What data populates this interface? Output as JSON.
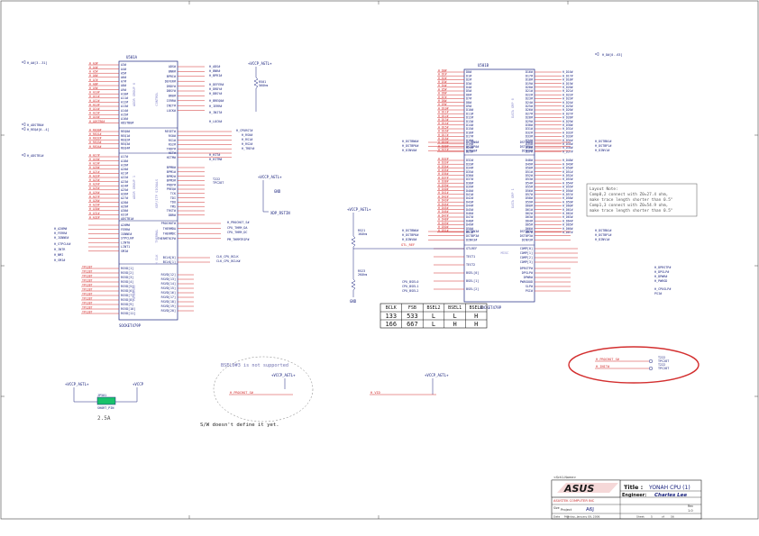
{
  "u1": {
    "ref": "U501A",
    "part": "SOCKET479P",
    "left_a_pins": [
      "A3#",
      "A4#",
      "A5#",
      "A6#",
      "A7#",
      "A8#",
      "A9#",
      "A10#",
      "A11#",
      "A12#",
      "A13#",
      "A14#",
      "A15#",
      "A16#",
      "ADSTB0#"
    ],
    "left_req_pins": [
      "REQ0#",
      "REQ1#",
      "REQ2#",
      "REQ3#",
      "REQ4#"
    ],
    "left_b_pins": [
      "A17#",
      "A18#",
      "A19#",
      "A20#",
      "A21#",
      "A22#",
      "A23#",
      "A24#",
      "A25#",
      "A26#",
      "A27#",
      "A28#",
      "A29#",
      "A30#",
      "A31#",
      "ADSTB1#"
    ],
    "left_misc_pins": [
      "A20M#",
      "FERR#",
      "IGNNE#",
      "STPCLK#",
      "LINT0",
      "LINT1",
      "SMI#"
    ],
    "left_rsvd_pins": [
      "RSVD[1]",
      "RSVD[2]",
      "RSVD[3]",
      "RSVD[4]",
      "RSVD[5]",
      "RSVD[6]",
      "RSVD[7]",
      "RSVD[8]",
      "RSVD[9]",
      "RSVD[10]",
      "RSVD[11]"
    ],
    "right_ctrl_pins": [
      "ADS#",
      "BNR#",
      "BPRI#",
      "DEFER#",
      "DRDY#",
      "DBSY#",
      "BR0#",
      "IERR#",
      "INIT#",
      "LOCK#"
    ],
    "right_rs_pins": [
      "RESET#",
      "RS0#",
      "RS1#",
      "RS2#",
      "TRDY#",
      "HIT#",
      "HITM#"
    ],
    "right_bpm_pins": [
      "BPM0#",
      "BPM1#",
      "BPM2#",
      "BPM3#",
      "PRDY#",
      "PREQ#",
      "TCK",
      "TDI",
      "TDO",
      "TMS",
      "TRST#",
      "DBR#"
    ],
    "right_therm_pins": [
      "PROCHOT#",
      "THERMDA",
      "THERMDC",
      "THERMTRIP#"
    ],
    "right_clk_pins": [
      "BCLK[0]",
      "BCLK[1]"
    ],
    "right_rsvd_pins": [
      "RSVD[12]",
      "RSVD[13]",
      "RSVD[14]",
      "RSVD[15]",
      "RSVD[16]",
      "RSVD[17]",
      "RSVD[18]",
      "RSVD[19]",
      "RSVD[20]"
    ],
    "group_labels": [
      "ADDR GROUP 0",
      "ADDR GROUP 1",
      "CONTROL",
      "XDP/ITP SIGNALS",
      "THERMAL",
      "H CLK",
      "RESERVED"
    ]
  },
  "u2": {
    "ref": "U501B",
    "part": "SOCKET479P",
    "left_d0_pins": [
      "D0#",
      "D1#",
      "D2#",
      "D3#",
      "D4#",
      "D5#",
      "D6#",
      "D7#",
      "D8#",
      "D9#",
      "D10#",
      "D11#",
      "D12#",
      "D13#",
      "D14#",
      "D15#",
      "D16#",
      "D17#",
      "D18#",
      "D19#",
      "D20#",
      "D21#",
      "D22#",
      "D23#",
      "D24#",
      "D25#",
      "D26#",
      "D27#",
      "D28#",
      "D29#",
      "D30#",
      "D31#"
    ],
    "left_d1_pins": [
      "D32#",
      "D33#",
      "D34#",
      "D35#",
      "D36#",
      "D37#",
      "D38#",
      "D39#",
      "D40#",
      "D41#",
      "D42#",
      "D43#",
      "D44#",
      "D45#",
      "D46#",
      "D47#",
      "D48#",
      "D49#",
      "D50#",
      "D51#",
      "D52#",
      "D53#",
      "D54#",
      "D55#",
      "D56#",
      "D57#",
      "D58#",
      "D59#",
      "D60#",
      "D61#",
      "D62#",
      "D63#"
    ],
    "right_strobe_top": [
      "DSTBN0#",
      "DSTBP0#",
      "DINV0#"
    ],
    "right_strobe_bot": [
      "DSTBN3#",
      "DSTBP3#",
      "DINV3#"
    ],
    "misc_pins": [
      "GTLREF",
      "TEST1",
      "TEST2",
      "BSEL[0]",
      "BSEL[1]",
      "BSEL[2]"
    ],
    "comp_pins": [
      "COMP[0]",
      "COMP[1]",
      "COMP[2]",
      "COMP[3]"
    ],
    "pwr_pins": [
      "DPRSTP#",
      "DPSLP#",
      "DPWR#",
      "PWRGOOD",
      "SLP#",
      "PSI#"
    ],
    "group_labels": [
      "DATA GRP 0",
      "DATA GRP 1",
      "MISC"
    ]
  },
  "nets": {
    "h_a": "H_A#[3..31]",
    "h_adstb0": "H_ADSTB0#",
    "h_req": "H_REQ#[0..4]",
    "h_adstb1": "H_ADSTB1#",
    "h_ads": "H_ADS#",
    "h_bnr": "H_BNR#",
    "h_bpri": "H_BPRI#",
    "h_defer": "H_DEFER#",
    "h_drdy": "H_DRDY#",
    "h_dbsy": "H_DBSY#",
    "h_breq0": "H_BREQ0#",
    "h_ierr": "H_IERR#",
    "h_init": "H_INIT#",
    "h_lock": "H_LOCK#",
    "h_cpurst": "H_CPURST#",
    "h_rs0": "H_RS0#",
    "h_rs1": "H_RS1#",
    "h_rs2": "H_RS2#",
    "h_trdy": "H_TRDY#",
    "h_hit": "H_HIT#",
    "h_hitm": "H_HITM#",
    "h_a20m": "H_A20M#",
    "h_ferr": "H_FERR#",
    "h_ignne": "H_IGNNE#",
    "h_stpclk": "H_STPCLK#",
    "h_intr": "H_INTR",
    "h_nmi": "H_NMI",
    "h_smi": "H_SMI#",
    "h_prochot": "H_PROCHOT_S#",
    "cpu_therm_da": "CPU_THRM_DA",
    "cpu_therm_dc": "CPU_THRM_DC",
    "pm_thrmtrip": "PM_THRMTRIP#",
    "clk_bclk": "CLK_CPU_BCLK",
    "clk_bclk_n": "CLK_CPU_BCLK#",
    "xdp_rstin": "XDP_RSTIN",
    "h_dstbn0": "H_DSTBN0#",
    "h_dstbp0": "H_DSTBP0#",
    "h_dinv0": "H_DINV0#",
    "h_dstbn1": "H_DSTBN1#",
    "h_dstbp1": "H_DSTBP1#",
    "h_dinv1": "H_DINV1#",
    "h_d": "H_D#[0..63]",
    "h_dpslp": "H_DPSLP#",
    "h_dprstp": "H_DPRSTP#",
    "h_dpwr": "H_DPWR#",
    "h_pwrgd": "H_PWRGD",
    "h_cpuslp": "H_CPUSLP#",
    "psi": "PSI#",
    "cpu_bsel0": "CPU_BSEL0",
    "cpu_bsel1": "CPU_BSEL1",
    "cpu_bsel2": "CPU_BSEL2",
    "h_gtlref": "GTL_REF",
    "h_prochot_s": "H_PROCHOT_S#",
    "h_vid": "H_VID",
    "vccp_agtl": "+VCCP_AGTL+",
    "vccp": "+VCCP",
    "gnd": "GND",
    "tpc": "TPC28T"
  },
  "components": {
    "r1_ref": "R501",
    "r1_val": "56Ohm",
    "r2_ref": "R521",
    "r2_val": "1KOhm",
    "r3_ref": "R523",
    "r3_val": "2KOhm",
    "jp_ref": "JP501",
    "jp_val": "SHORT_PIN",
    "rcomp_ref": "R531",
    "rcomp_val": "27.4Ohm",
    "rtest_ref": "R532",
    "rtest_val": "1KOhm",
    "tp_ref": "T222",
    "size_label": "2.5A"
  },
  "bsel_table": {
    "headers": [
      "BCLK",
      "FSB",
      "BSEL2",
      "BSEL1",
      "BSEL0"
    ],
    "rows": [
      [
        "133",
        "533",
        "L",
        "L",
        "H"
      ],
      [
        "166",
        "667",
        "L",
        "H",
        "H"
      ]
    ]
  },
  "notes": {
    "layout_note_lines": [
      "Layout Note:",
      "Comp0,2 connect with Z0=27.4 ohm,",
      "make trace length shorter than 0.5\"",
      "Comp1,3 connect with Z0=54.9 ohm,",
      "make trace length shorter than 0.5\""
    ],
    "bsel_note": "BSEL0#3 is not supported",
    "sw_note": "S/W doesn't define it yet."
  },
  "titleblock": {
    "brand": "ASUS",
    "company": "ASUSTEK COMPUTER INC",
    "title_label": "Title :",
    "title": "YONAH CPU (1)",
    "engineer_label": "Engineer:",
    "engineer": "Charles Lee",
    "project_label": "Project",
    "project": "A6J",
    "size_label": "Size",
    "rev_label": "Rev",
    "rev": "1.0",
    "sheet_label": "Sheet",
    "date_label": "Date",
    "date": "Monday, January 09, 2006",
    "sheet": "5",
    "of_label": "of",
    "sheets": "56",
    "header_tag": "<Sch1-Name>"
  },
  "colors": {
    "wire": "#1a237e",
    "pin": "#d32f2f",
    "box": "#1a237e",
    "highlight": "#d32f2f",
    "jumper": "#19c26b"
  }
}
